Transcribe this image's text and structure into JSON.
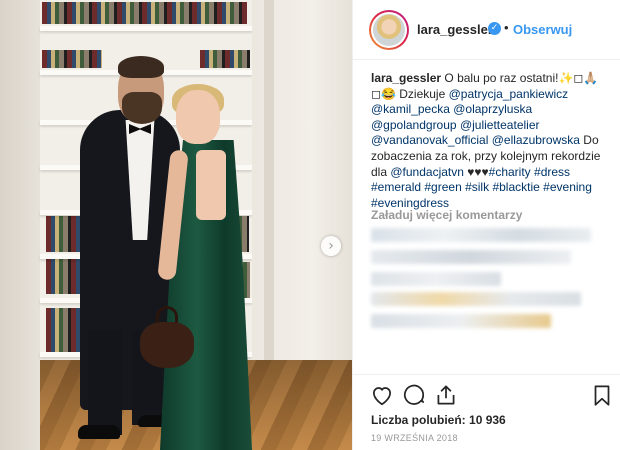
{
  "post": {
    "username": "lara_gessler",
    "follow_label": "Obserwuj",
    "separator": "•",
    "caption_parts": [
      {
        "type": "user",
        "text": "lara_gessler"
      },
      {
        "type": "text",
        "text": " O balu po raz ostatni!✨◻🙏🏼 ◻😂 Dziekuje "
      },
      {
        "type": "tag",
        "text": "@patrycja_pankiewicz"
      },
      {
        "type": "text",
        "text": " "
      },
      {
        "type": "tag",
        "text": "@kamil_pecka"
      },
      {
        "type": "text",
        "text": " "
      },
      {
        "type": "tag",
        "text": "@olaprzyluska"
      },
      {
        "type": "text",
        "text": " "
      },
      {
        "type": "tag",
        "text": "@gpolandgroup"
      },
      {
        "type": "text",
        "text": " "
      },
      {
        "type": "tag",
        "text": "@julietteatelier"
      },
      {
        "type": "text",
        "text": " "
      },
      {
        "type": "tag",
        "text": "@vandanovak_official"
      },
      {
        "type": "text",
        "text": " "
      },
      {
        "type": "tag",
        "text": "@ellazubrowska"
      },
      {
        "type": "text",
        "text": " Do zobaczenia za rok, przy kolejnym rekordzie dla "
      },
      {
        "type": "tag",
        "text": "@fundacjatvn"
      },
      {
        "type": "text",
        "text": " ♥♥♥"
      },
      {
        "type": "tag",
        "text": "#charity"
      },
      {
        "type": "text",
        "text": " "
      },
      {
        "type": "tag",
        "text": "#dress"
      },
      {
        "type": "text",
        "text": " "
      },
      {
        "type": "tag",
        "text": "#emerald"
      },
      {
        "type": "text",
        "text": " "
      },
      {
        "type": "tag",
        "text": "#green"
      },
      {
        "type": "text",
        "text": " "
      },
      {
        "type": "tag",
        "text": "#silk"
      },
      {
        "type": "text",
        "text": " "
      },
      {
        "type": "tag",
        "text": "#blacktie"
      },
      {
        "type": "text",
        "text": " "
      },
      {
        "type": "tag",
        "text": "#evening"
      },
      {
        "type": "text",
        "text": " "
      },
      {
        "type": "tag",
        "text": "#eveningdress"
      }
    ],
    "load_more_label": "Załaduj więcej komentarzy",
    "likes_label": "Liczba polubień:",
    "likes_count": "10 936",
    "date": "19 WRZEŚNIA 2018",
    "icons": {
      "verified": "verified-badge-icon",
      "like": "heart-icon",
      "comment": "comment-bubble-icon",
      "share": "share-arrow-icon",
      "save": "bookmark-icon",
      "next": "chevron-right-icon"
    },
    "colors": {
      "link": "#003569",
      "follow": "#3897f0",
      "muted": "#999999"
    }
  }
}
